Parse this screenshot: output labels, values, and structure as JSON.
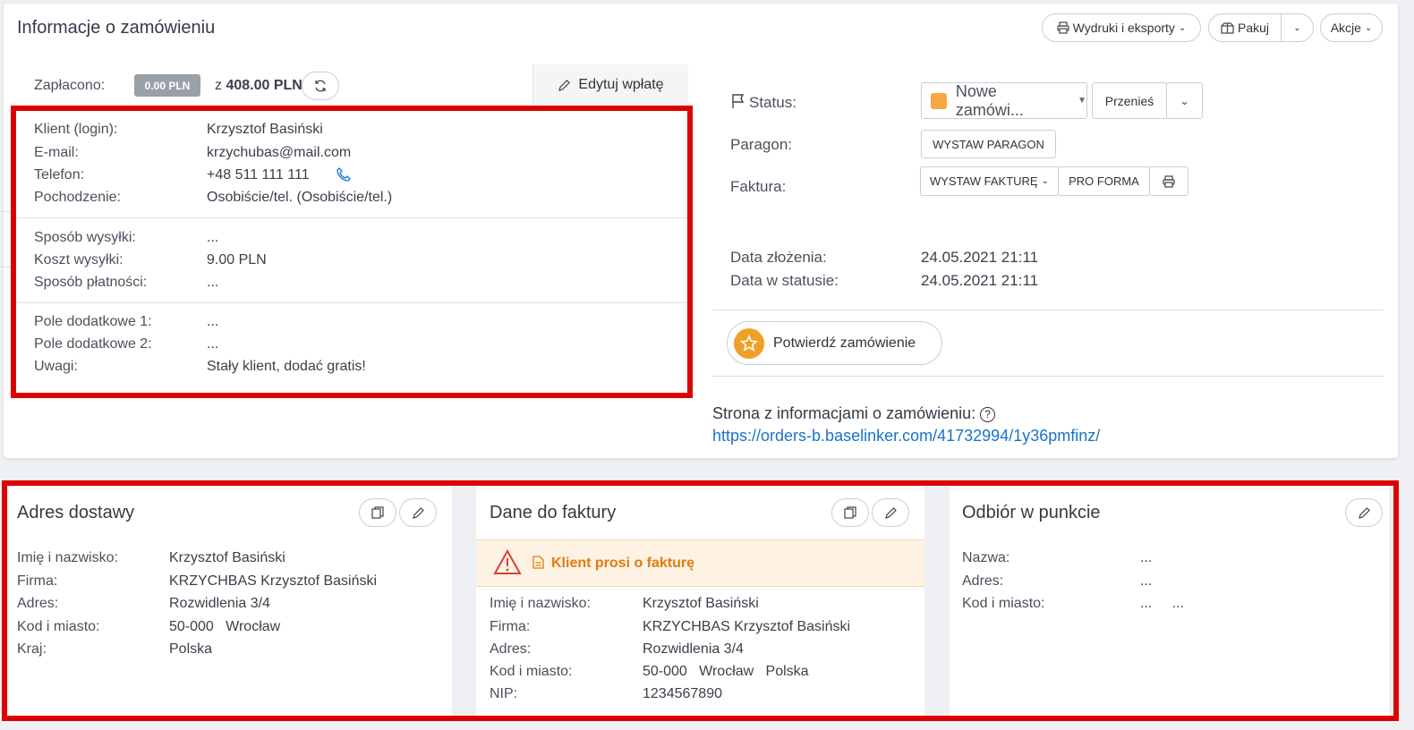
{
  "header": {
    "title": "Informacje o zamówieniu",
    "exports_label": "Wydruki i eksporty",
    "pack_label": "Pakuj",
    "actions_label": "Akcje"
  },
  "payment": {
    "paid_label": "Zapłacono:",
    "paid_badge": "0.00 PLN",
    "of_prefix": "z",
    "total": "408.00 PLN",
    "edit_label": "Edytuj wpłatę"
  },
  "client": {
    "rows": [
      {
        "label": "Klient (login):",
        "value": "Krzysztof Basiński"
      },
      {
        "label": "E-mail:",
        "value": "krzychubas@mail.com"
      },
      {
        "label": "Telefon:",
        "value": "+48 511 111 111"
      },
      {
        "label": "Pochodzenie:",
        "value": "Osobiście/tel. (Osobiście/tel.)"
      }
    ],
    "shipping": [
      {
        "label": "Sposób wysyłki:",
        "value": "..."
      },
      {
        "label": "Koszt wysyłki:",
        "value": "9.00 PLN"
      },
      {
        "label": "Sposób płatności:",
        "value": "..."
      }
    ],
    "extra": [
      {
        "label": "Pole dodatkowe 1:",
        "value": "..."
      },
      {
        "label": "Pole dodatkowe 2:",
        "value": "..."
      },
      {
        "label": "Uwagi:",
        "value": "Stały klient, dodać gratis!"
      }
    ]
  },
  "status": {
    "status_label": "Status:",
    "status_value": "Nowe zamówi...",
    "status_color": "#f5a742",
    "move_label": "Przenieś",
    "receipt_label": "Paragon:",
    "receipt_btn": "WYSTAW PARAGON",
    "invoice_label": "Faktura:",
    "invoice_btn": "WYSTAW FAKTURĘ",
    "proforma_btn": "PRO FORMA",
    "date_created_label": "Data złożenia:",
    "date_created": "24.05.2021 21:11",
    "date_status_label": "Data w statusie:",
    "date_status": "24.05.2021 21:11",
    "confirm_label": "Potwierdź zamówienie",
    "info_page_label": "Strona z informacjami o zamówieniu:",
    "info_page_url": "https://orders-b.baselinker.com/41732994/1y36pmfinz/"
  },
  "delivery": {
    "title": "Adres dostawy",
    "rows": [
      {
        "label": "Imię i nazwisko:",
        "value": "Krzysztof Basiński"
      },
      {
        "label": "Firma:",
        "value": "KRZYCHBAS Krzysztof Basiński"
      },
      {
        "label": "Adres:",
        "value": "Rozwidlenia 3/4"
      },
      {
        "label": "Kod i miasto:",
        "value": "50-000   Wrocław"
      },
      {
        "label": "Kraj:",
        "value": "Polska"
      }
    ]
  },
  "invoice": {
    "title": "Dane do faktury",
    "warning": "Klient prosi o fakturę",
    "warning_color": "#e07b10",
    "rows": [
      {
        "label": "Imię i nazwisko:",
        "value": "Krzysztof Basiński"
      },
      {
        "label": "Firma:",
        "value": "KRZYCHBAS Krzysztof Basiński"
      },
      {
        "label": "Adres:",
        "value": "Rozwidlenia 3/4"
      },
      {
        "label": "Kod i miasto:",
        "value": "50-000   Wrocław   Polska"
      },
      {
        "label": "NIP:",
        "value": "1234567890"
      }
    ]
  },
  "pickup": {
    "title": "Odbiór w punkcie",
    "rows": [
      {
        "label": "Nazwa:",
        "value": "..."
      },
      {
        "label": "Adres:",
        "value": "..."
      },
      {
        "label": "Kod i miasto:",
        "value": "...     ..."
      }
    ]
  }
}
